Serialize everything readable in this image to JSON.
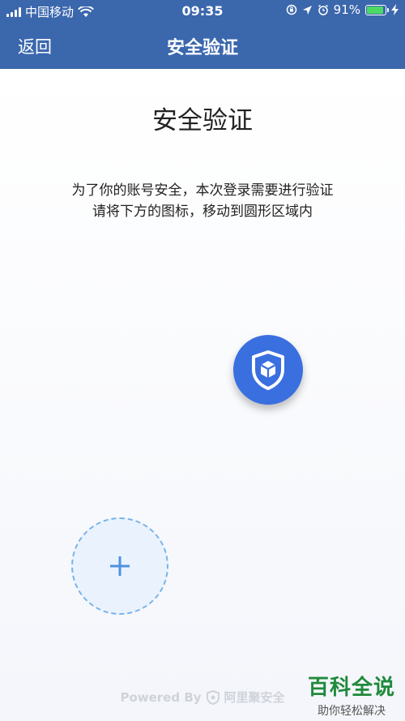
{
  "status_bar": {
    "carrier": "中国移动",
    "time": "09:35",
    "battery_percent": "91%",
    "battery_level": 0.91,
    "accent_battery": "#4cd964"
  },
  "nav": {
    "back_label": "返回",
    "title": "安全验证"
  },
  "main": {
    "title": "安全验证",
    "instruction_line1": "为了你的账号安全，本次登录需要进行验证",
    "instruction_line2": "请将下方的图标，移动到圆形区域内",
    "drag_icon": "shield-cube-icon",
    "target_icon": "plus-icon"
  },
  "footer": {
    "powered_by": "Powered By",
    "provider": "阿里聚安全"
  },
  "watermark": {
    "main": "百科全说",
    "sub": "助你轻松解决"
  },
  "colors": {
    "header_blue": "#3b67ad",
    "button_blue": "#3a6fe0",
    "target_border": "#7ab3ec",
    "target_fill": "#eaf3fd",
    "watermark_green": "#1f8a3b"
  }
}
